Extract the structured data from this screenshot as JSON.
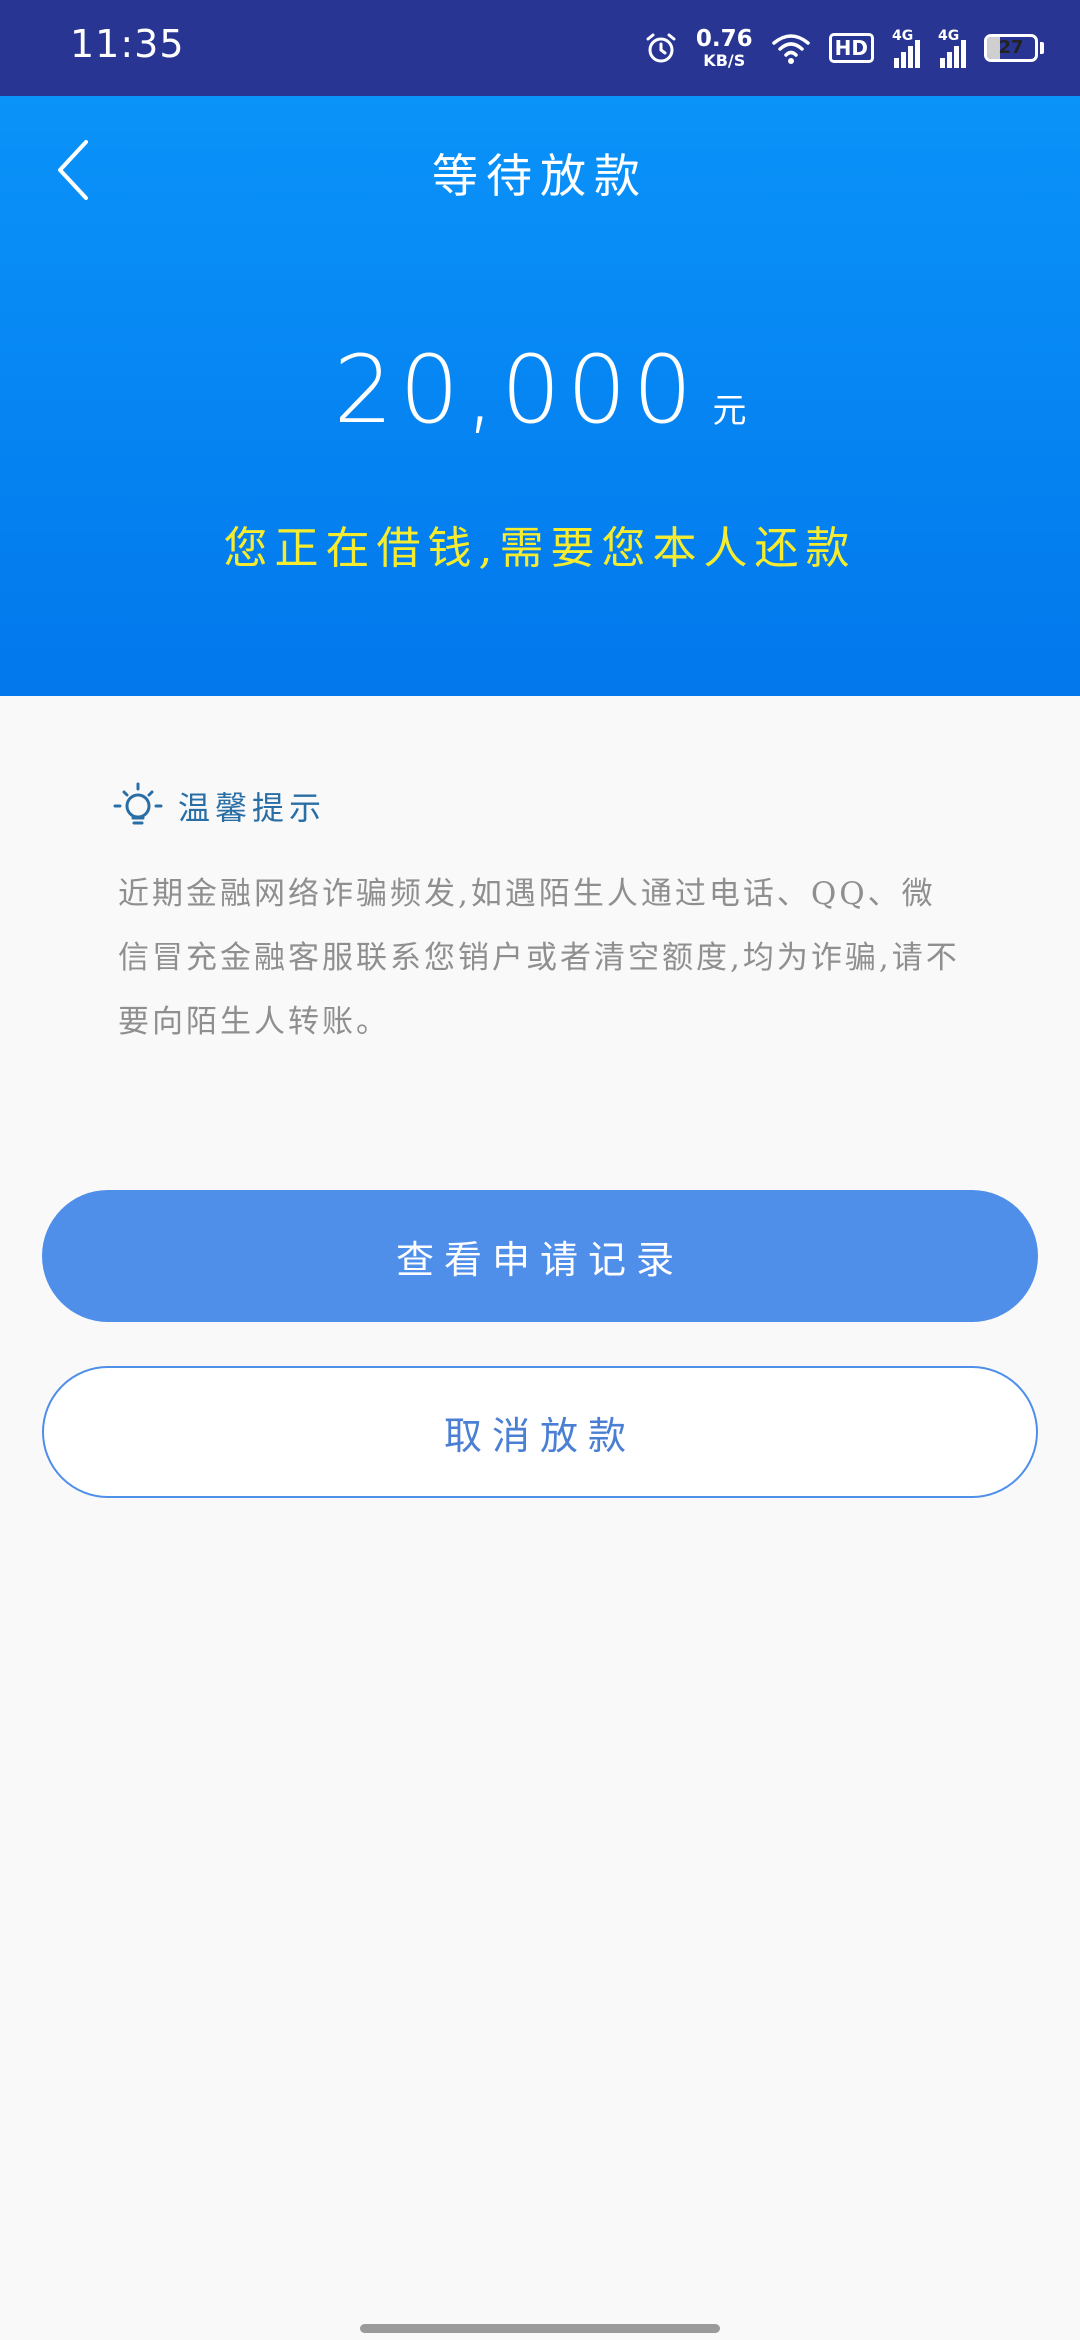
{
  "status_bar": {
    "time": "11:35",
    "net_speed_value": "0.76",
    "net_speed_unit": "KB/S",
    "hd_label": "HD",
    "signal1_label": "4G",
    "signal2_label": "4G",
    "battery_level": "27",
    "icons": [
      "alarm-icon",
      "wifi-icon",
      "signal-icon",
      "battery-icon"
    ]
  },
  "header": {
    "title": "等待放款",
    "back_icon": "chevron-left-icon"
  },
  "loan": {
    "amount": "20,000",
    "unit": "元",
    "notice": "您正在借钱,需要您本人还款"
  },
  "tip": {
    "icon": "lightbulb-icon",
    "title": "温馨提示",
    "text": "近期金融网络诈骗频发,如遇陌生人通过电话、QQ、微信冒充金融客服联系您销户或者清空额度,均为诈骗,请不要向陌生人转账。"
  },
  "actions": {
    "view_records": "查看申请记录",
    "cancel_loan": "取消放款"
  },
  "colors": {
    "status_bar": "#283593",
    "hero_top": "#0a93f9",
    "hero_bottom": "#0278ec",
    "notice_yellow": "#f5ec2f",
    "primary_button": "#4f8fea"
  }
}
